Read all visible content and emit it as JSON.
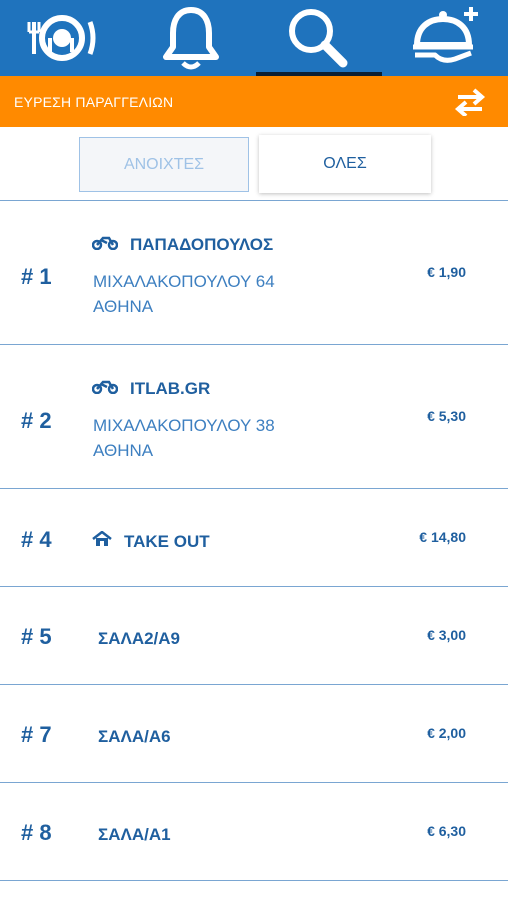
{
  "nav": {
    "tabs": [
      {
        "name": "store-logo",
        "icon": "store-logo-icon"
      },
      {
        "name": "notifications",
        "icon": "bell-icon"
      },
      {
        "name": "search",
        "icon": "search-icon",
        "active": true
      },
      {
        "name": "new-order",
        "icon": "serving-tray-plus-icon"
      }
    ]
  },
  "header": {
    "title": "ΕΥΡΕΣΗ ΠΑΡΑΓΓΕΛΙΩΝ",
    "action_icon": "swap-arrows-icon"
  },
  "filters": {
    "open_label": "ΑΝΟΙΧΤΕΣ",
    "all_label": "ΟΛΕΣ",
    "selected": "all"
  },
  "orders": [
    {
      "number": "# 1",
      "icon": "motorcycle-icon",
      "name": "ΠΑΠΑΔΟΠΟΥΛΟΣ",
      "address": "ΜΙΧΑΛΑΚΟΠΟΥΛΟΥ 64",
      "city": "ΑΘΗΝΑ",
      "price": "€ 1,90"
    },
    {
      "number": "# 2",
      "icon": "motorcycle-icon",
      "name": "ITLAB.GR",
      "address": "ΜΙΧΑΛΑΚΟΠΟΥΛΟΥ 38",
      "city": "ΑΘΗΝΑ",
      "price": "€ 5,30"
    },
    {
      "number": "# 4",
      "icon": "home-icon",
      "name": "TAKE OUT",
      "price": "€ 14,80"
    },
    {
      "number": "# 5",
      "name": "ΣΑΛΑ2/Α9",
      "price": "€ 3,00"
    },
    {
      "number": "# 7",
      "name": "ΣΑΛΑ/Α6",
      "price": "€ 2,00"
    },
    {
      "number": "# 8",
      "name": "ΣΑΛΑ/Α1",
      "price": "€ 6,30"
    }
  ],
  "colors": {
    "nav_blue": "#1f73bd",
    "header_orange": "#ff8a00",
    "text_blue": "#1f5f9f",
    "divider": "#7aa6d2"
  }
}
